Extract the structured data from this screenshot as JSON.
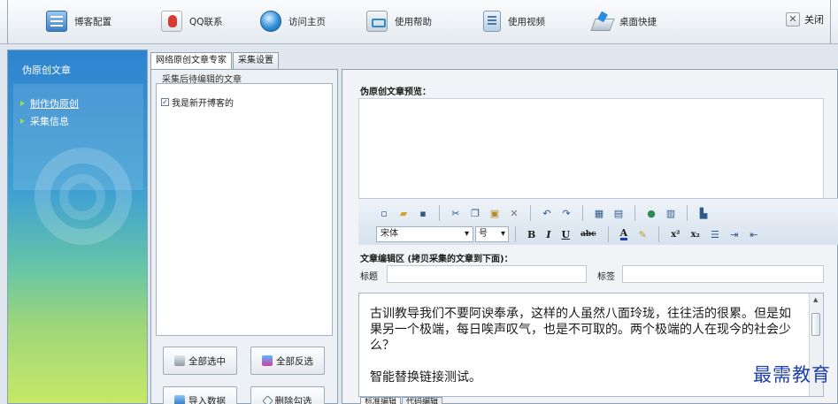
{
  "toolbar": {
    "items": [
      {
        "label": "博客配置",
        "icon": "blog-config-icon"
      },
      {
        "label": "QQ联系",
        "icon": "qq-icon"
      },
      {
        "label": "访问主页",
        "icon": "globe-icon"
      },
      {
        "label": "使用帮助",
        "icon": "help-icon"
      },
      {
        "label": "使用视频",
        "icon": "video-icon"
      },
      {
        "label": "桌面快捷",
        "icon": "desktop-shortcut-icon"
      }
    ],
    "close_label": "关闭",
    "close_glyph": "✕"
  },
  "sidebar": {
    "title": "伪原创文章",
    "items": [
      {
        "label": "制作伪原创",
        "active": true
      },
      {
        "label": "采集信息",
        "active": false
      }
    ]
  },
  "middle": {
    "tabs": [
      "网络原创文章专家",
      "采集设置"
    ],
    "group_label": "采集后待编辑的文章",
    "list_items": [
      {
        "label": "我是新开博客的",
        "checked": true
      }
    ],
    "buttons": {
      "select_all": "全部选中",
      "invert": "全部反选",
      "import": "导入数据",
      "delete": "删除勾选"
    }
  },
  "right": {
    "preview_label": "伪原创文章预览：",
    "font_name": "宋体",
    "font_size": "号",
    "edit_label": "文章编辑区 (拷贝采集的文章到下面)：",
    "title_label": "标题",
    "tag_label": "标签",
    "title_value": "",
    "tag_value": "",
    "paragraphs": [
      "古训教导我们不要阿谀奉承，这样的人虽然八面玲珑，往往活的很累。但是如果另一个极端，每日唉声叹气，也是不可取的。两个极端的人在现今的社会少么？",
      "智能替换链接测试。"
    ],
    "mode_tabs": [
      "标准编辑",
      "代码编辑"
    ]
  },
  "watermark": "最需教育",
  "colors": {
    "sidebar_top": "#2f83cf",
    "sidebar_bottom": "#c7e867",
    "watermark": "#1e3fb0"
  }
}
